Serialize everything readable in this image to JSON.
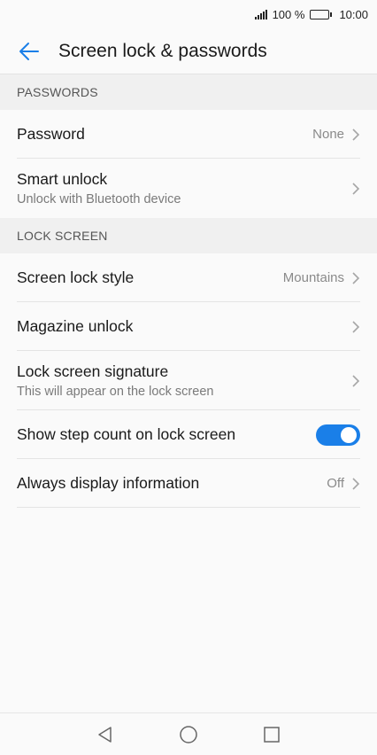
{
  "status": {
    "battery": "100 %",
    "time": "10:00"
  },
  "header": {
    "title": "Screen lock & passwords"
  },
  "sections": [
    {
      "label": "PASSWORDS",
      "items": [
        {
          "title": "Password",
          "value": "None"
        },
        {
          "title": "Smart unlock",
          "subtitle": "Unlock with Bluetooth device"
        }
      ]
    },
    {
      "label": "LOCK SCREEN",
      "items": [
        {
          "title": "Screen lock style",
          "value": "Mountains"
        },
        {
          "title": "Magazine unlock"
        },
        {
          "title": "Lock screen signature",
          "subtitle": "This will appear on the lock screen"
        },
        {
          "title": "Show step count on lock screen",
          "toggle": true
        },
        {
          "title": "Always display information",
          "value": "Off"
        }
      ]
    }
  ],
  "colors": {
    "accent": "#1a7fe8",
    "background": "#fafafa",
    "section": "#f0f0f0"
  }
}
